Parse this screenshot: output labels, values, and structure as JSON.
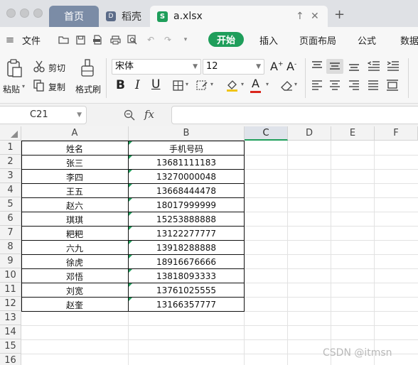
{
  "titlebar": {
    "tabs": [
      {
        "label": "首页",
        "active": false
      },
      {
        "label": "稻壳",
        "active": false
      },
      {
        "label": "a.xlsx",
        "active": true
      }
    ],
    "file_icon": "S",
    "daoke_icon": "D"
  },
  "menu": {
    "file_label": "文件",
    "items": [
      "开始",
      "插入",
      "页面布局",
      "公式",
      "数据"
    ],
    "active_item": "开始"
  },
  "ribbon": {
    "paste_label": "粘贴",
    "cut_label": "剪切",
    "copy_label": "复制",
    "format_painter_label": "格式刷",
    "font_name": "宋体",
    "font_size": "12",
    "bold": "B",
    "italic": "I",
    "underline": "U",
    "font_color_letter": "A"
  },
  "formula_bar": {
    "cell_ref": "C21",
    "fx_label": "fx",
    "value": ""
  },
  "sheet": {
    "columns": [
      "A",
      "B",
      "C",
      "D",
      "E",
      "F"
    ],
    "selected_column": "C",
    "row_numbers": [
      "1",
      "2",
      "3",
      "4",
      "5",
      "6",
      "7",
      "8",
      "9",
      "10",
      "11",
      "12",
      "13",
      "14",
      "15",
      "16"
    ],
    "header": {
      "name": "姓名",
      "phone": "手机号码"
    },
    "rows": [
      {
        "name": "张三",
        "phone": "13681111183"
      },
      {
        "name": "李四",
        "phone": "13270000048"
      },
      {
        "name": "王五",
        "phone": "13668444478"
      },
      {
        "name": "赵六",
        "phone": "18017999999"
      },
      {
        "name": "琪琪",
        "phone": "15253888888"
      },
      {
        "name": "粑粑",
        "phone": "13122277777"
      },
      {
        "name": "六九",
        "phone": "13918288888"
      },
      {
        "name": "徐虎",
        "phone": "18916676666"
      },
      {
        "name": "邓悟",
        "phone": "13818093333"
      },
      {
        "name": "刘宽",
        "phone": "13761025555"
      },
      {
        "name": "赵奎",
        "phone": "13166357777"
      }
    ]
  },
  "watermark": "CSDN @itmsn",
  "colors": {
    "accent": "#1f9e5b",
    "home_tab": "#7b8ca6"
  }
}
